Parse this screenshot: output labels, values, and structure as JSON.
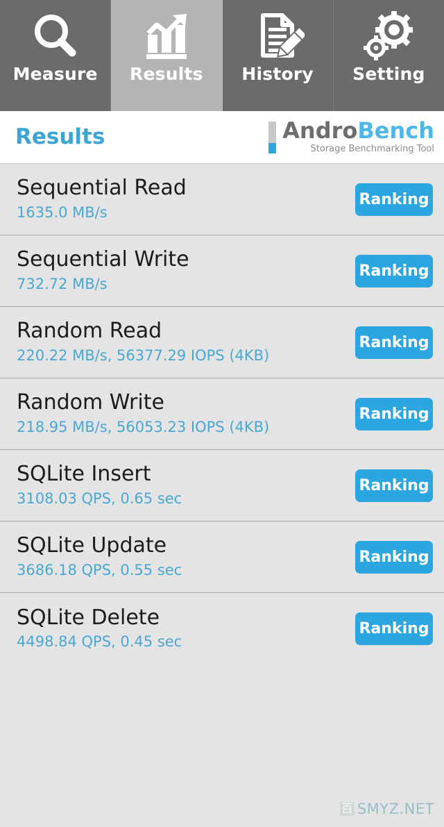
{
  "tabs": [
    {
      "label": "Measure",
      "icon": "magnifier-icon",
      "active": false
    },
    {
      "label": "Results",
      "icon": "bar-chart-trend-icon",
      "active": true
    },
    {
      "label": "History",
      "icon": "document-pencil-icon",
      "active": false
    },
    {
      "label": "Setting",
      "icon": "gears-icon",
      "active": false
    }
  ],
  "header": {
    "title": "Results",
    "logo_primary": "Andro",
    "logo_secondary": "Bench",
    "logo_subtitle": "Storage Benchmarking Tool"
  },
  "results": [
    {
      "name": "Sequential Read",
      "value": "1635.0 MB/s",
      "button": "Ranking"
    },
    {
      "name": "Sequential Write",
      "value": "732.72 MB/s",
      "button": "Ranking"
    },
    {
      "name": "Random Read",
      "value": "220.22 MB/s, 56377.29 IOPS (4KB)",
      "button": "Ranking"
    },
    {
      "name": "Random Write",
      "value": "218.95 MB/s, 56053.23 IOPS (4KB)",
      "button": "Ranking"
    },
    {
      "name": "SQLite Insert",
      "value": "3108.03 QPS, 0.65 sec",
      "button": "Ranking"
    },
    {
      "name": "SQLite Update",
      "value": "3686.18 QPS, 0.55 sec",
      "button": "Ranking"
    },
    {
      "name": "SQLite Delete",
      "value": "4498.84 QPS, 0.45 sec",
      "button": "Ranking"
    }
  ],
  "watermark": {
    "badge": "百",
    "text": "SMYZ.NET"
  },
  "colors": {
    "accent_blue": "#2ba6e0",
    "value_blue": "#4aa7d4",
    "title_blue": "#3ba6d4",
    "tab_bg": "#6b6b6b",
    "tab_active_bg": "#b4b4b4",
    "list_bg": "#e4e4e4",
    "row_divider": "#a8a8a8"
  }
}
